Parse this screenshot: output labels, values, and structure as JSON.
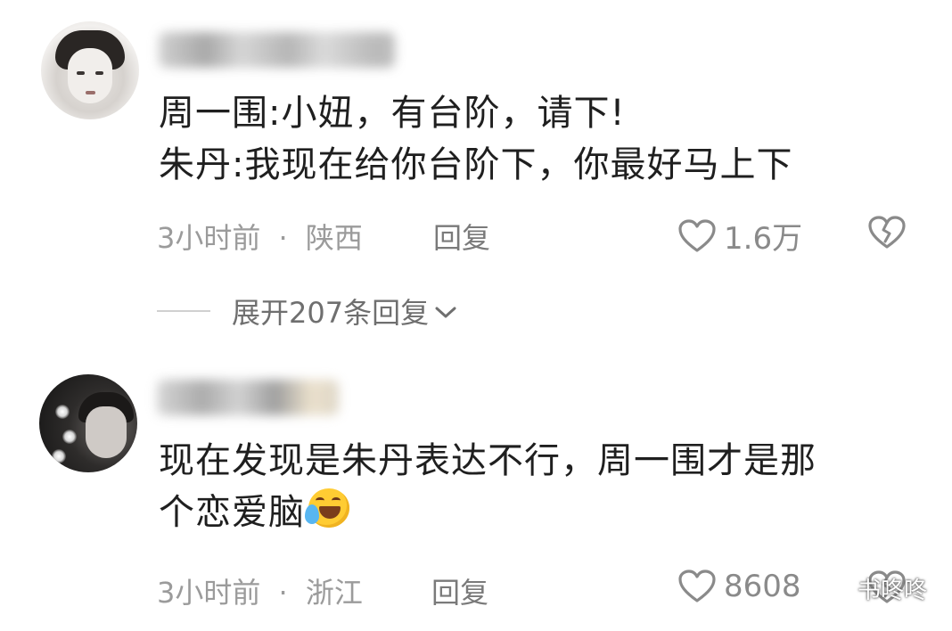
{
  "comments": [
    {
      "username": "",
      "text_lines": [
        "周一围:小妞，有台阶，请下!",
        "朱丹:我现在给你台阶下，你最好马上下"
      ],
      "time": "3小时前",
      "separator": "·",
      "location": "陕西",
      "reply_label": "回复",
      "likes": "1.6万",
      "expand_label": "展开207条回复"
    },
    {
      "username": "",
      "text_lines": [
        "现在发现是朱丹表达不行，周一围才是那",
        "个恋爱脑"
      ],
      "emoji": "laughing-with-tears",
      "time": "3小时前",
      "separator": "·",
      "location": "浙江",
      "reply_label": "回复",
      "likes": "8608"
    }
  ],
  "watermark": {
    "text": "书咚咚",
    "icon": "wechat-icon"
  },
  "colors": {
    "text": "#1f1f1f",
    "meta": "#9b9b9b",
    "icon": "#8a8a8a"
  }
}
